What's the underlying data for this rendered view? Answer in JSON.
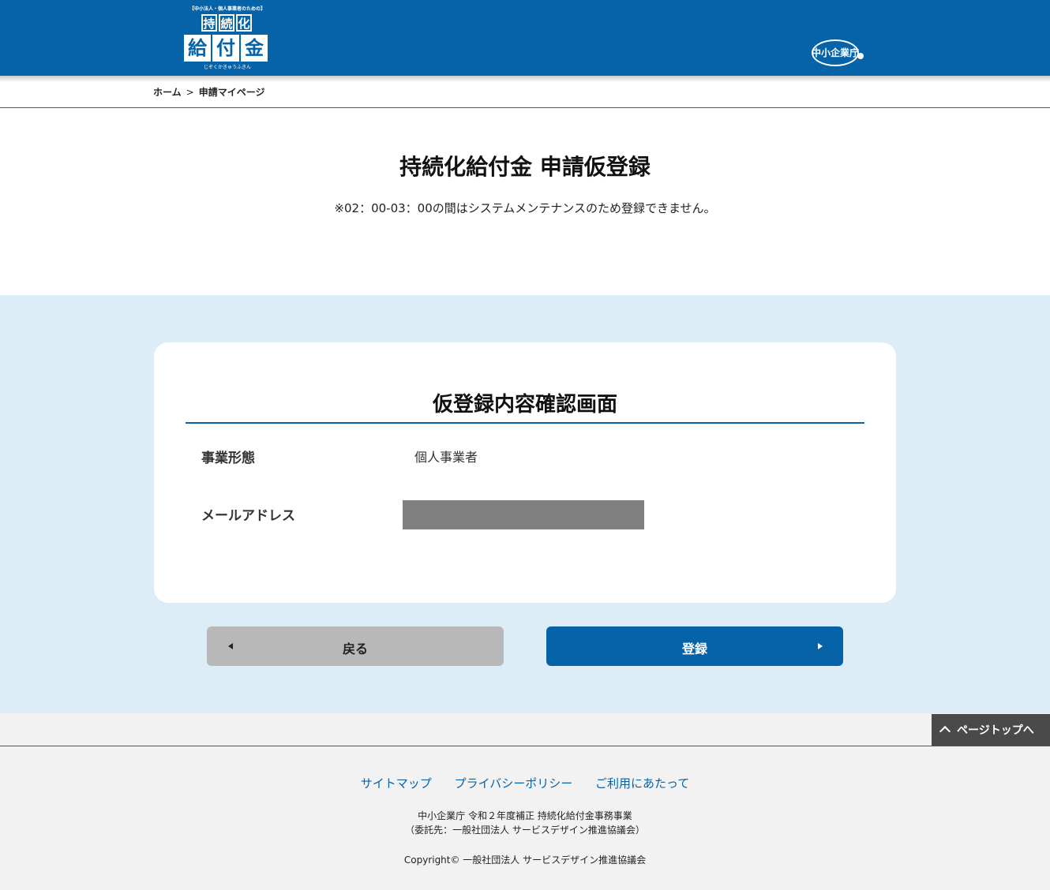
{
  "header": {
    "logo": {
      "top_text": "【中小法人・個人事業者のための】",
      "row1": [
        "持",
        "続",
        "化"
      ],
      "row2": [
        "給",
        "付",
        "金"
      ],
      "bottom_text": "じぞくかきゅうふきん"
    },
    "agency_logo_text": "中小企業庁",
    "background_color": "#0763a8"
  },
  "breadcrumb": {
    "home": "ホーム",
    "separator": ">",
    "current": "申請マイページ"
  },
  "page": {
    "title": "持続化給付金 申請仮登録",
    "notice": "※02：00-03：00の間はシステムメンテナンスのため登録できません。"
  },
  "card": {
    "title": "仮登録内容確認画面",
    "rows": [
      {
        "label": "事業形態",
        "value": "個人事業者"
      },
      {
        "label": "メールアドレス",
        "value": ""
      }
    ]
  },
  "buttons": {
    "back": "戻る",
    "register": "登録"
  },
  "page_top": "ページトップへ",
  "footer": {
    "links": [
      "サイトマップ",
      "プライバシーポリシー",
      "ご利用にあたって"
    ],
    "line1": "中小企業庁 令和２年度補正 持続化給付金事務事業",
    "line2": "（委託先：一般社団法人 サービスデザイン推進協議会）",
    "copyright": "Copyright© 一般社団法人 サービスデザイン推進協議会"
  },
  "colors": {
    "accent": "#0763a8",
    "section_bg": "#dcedf7",
    "back_button": "#b8b8b8",
    "footer_bg": "#f2f2f2",
    "redaction": "#808080"
  }
}
